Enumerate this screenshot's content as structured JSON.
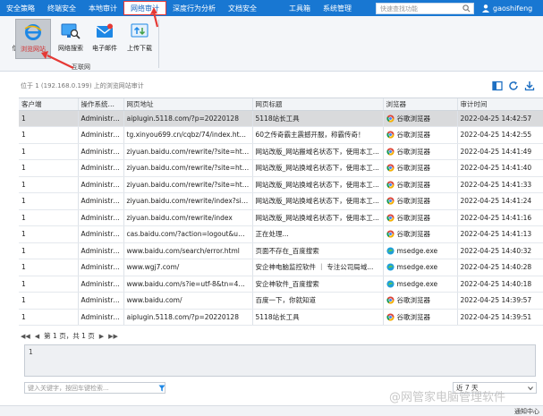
{
  "menubar": {
    "items": [
      "安全策略",
      "终端安全",
      "本地审计",
      "网络审计",
      "深度行为分析",
      "文档安全",
      "工具箱",
      "系统管理"
    ],
    "search_placeholder": "快速查找功能",
    "username": "gaoshifeng"
  },
  "ribbon": {
    "partial_label": "信",
    "buttons": [
      {
        "label": "浏览网站",
        "icon": "ie-browser-icon",
        "selected": true
      },
      {
        "label": "网络搜索",
        "icon": "search-monitor-icon",
        "selected": false
      },
      {
        "label": "电子邮件",
        "icon": "envelope-icon",
        "selected": false
      },
      {
        "label": "上传下载",
        "icon": "updown-icon",
        "selected": false
      }
    ],
    "group_label": "互联网"
  },
  "location": {
    "text": "位于 1 (192.168.0.199) 上的浏览网站审计"
  },
  "table": {
    "columns": [
      "客户端",
      "操作系统帐户",
      "网页地址",
      "网页标题",
      "浏览器",
      "审计时间"
    ],
    "rows": [
      [
        "1",
        "Administra...",
        "aiplugin.5118.com/?p=20220128",
        "5118站长工具",
        "谷歌浏览器",
        "2022-04-25 14:42:57"
      ],
      [
        "1",
        "Administra...",
        "tg.xinyou699.cn/cqbz/74/index.html...",
        "60之传奇霸主震撼开服，称霸传奇！",
        "谷歌浏览器",
        "2022-04-25 14:42:55"
      ],
      [
        "1",
        "Administra...",
        "ziyuan.baidu.com/rewrite/?site=http...",
        "网站改版_网站搬域名状态下，使用本工...",
        "谷歌浏览器",
        "2022-04-25 14:41:49"
      ],
      [
        "1",
        "Administra...",
        "ziyuan.baidu.com/rewrite/?site=http...",
        "网站改版_网站换域名状态下，使用本工...",
        "谷歌浏览器",
        "2022-04-25 14:41:40"
      ],
      [
        "1",
        "Administra...",
        "ziyuan.baidu.com/rewrite/?site=http...",
        "网站改版_网站换域名状态下，使用本工...",
        "谷歌浏览器",
        "2022-04-25 14:41:33"
      ],
      [
        "1",
        "Administra...",
        "ziyuan.baidu.com/rewrite/index?site=...",
        "网站改版_网站换域名状态下，使用本工...",
        "谷歌浏览器",
        "2022-04-25 14:41:24"
      ],
      [
        "1",
        "Administra...",
        "ziyuan.baidu.com/rewrite/index",
        "网站改版_网站换域名状态下，使用本工...",
        "谷歌浏览器",
        "2022-04-25 14:41:16"
      ],
      [
        "1",
        "Administra...",
        "cas.baidu.com/?action=logout&u=h...",
        "正在处理...",
        "谷歌浏览器",
        "2022-04-25 14:41:13"
      ],
      [
        "1",
        "Administra...",
        "www.baidu.com/search/error.html",
        "页面不存在_百度搜索",
        "msedge.exe",
        "2022-04-25 14:40:32"
      ],
      [
        "1",
        "Administra...",
        "www.wgj7.com/",
        "安企神电脑监控软件 ｜ 专注公司局域...",
        "msedge.exe",
        "2022-04-25 14:40:28"
      ],
      [
        "1",
        "Administra...",
        "www.baidu.com/s?ie=utf-8&tn=490...",
        "安企神软件_百度搜索",
        "msedge.exe",
        "2022-04-25 14:40:18"
      ],
      [
        "1",
        "Administra...",
        "www.baidu.com/",
        "百度一下，你就知道",
        "谷歌浏览器",
        "2022-04-25 14:39:57"
      ],
      [
        "1",
        "Administra...",
        "aiplugin.5118.com/?p=20220128",
        "5118站长工具",
        "谷歌浏览器",
        "2022-04-25 14:39:51"
      ]
    ],
    "selected_row": 0
  },
  "pager": {
    "text": "第 1 页，共 1 页"
  },
  "detail": {
    "text": "1"
  },
  "bottom": {
    "keyword_placeholder": "键入关键字，按回车键检索...",
    "range_value": "近 7 天",
    "status_right": "通知中心"
  },
  "watermark": "@网管家电脑管理软件",
  "colors": {
    "menubar": "#1877d2",
    "highlight": "#e53935",
    "selected_row": "#d9dadc"
  }
}
